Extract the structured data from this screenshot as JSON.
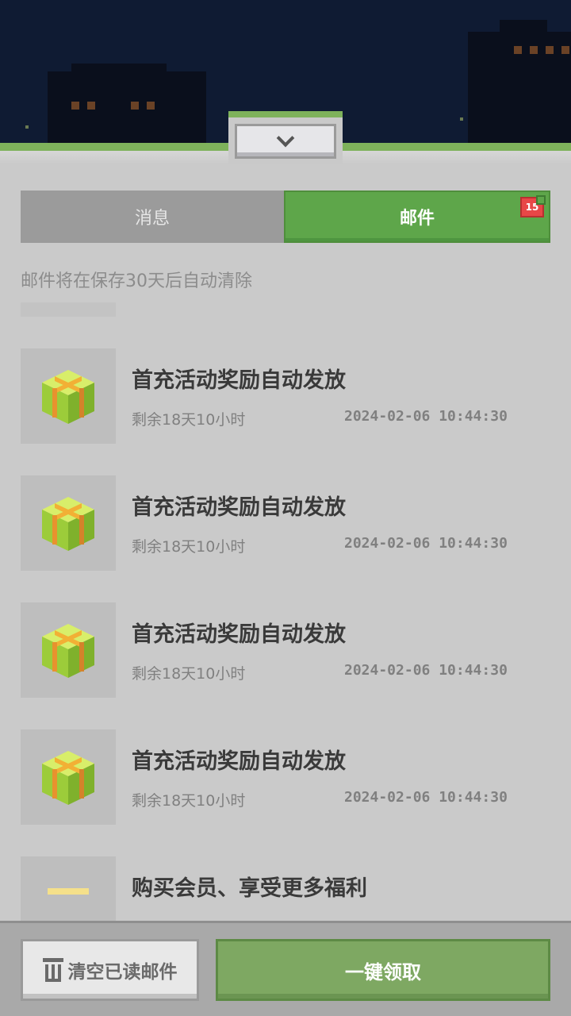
{
  "tabs": {
    "messages": "消息",
    "mail": "邮件",
    "mail_badge": "15"
  },
  "notice": "邮件将在保存30天后自动清除",
  "mails": [
    {
      "icon": "gift-box-icon",
      "title": "首充活动奖励自动发放",
      "remaining": "剩余18天10小时",
      "date": "2024-02-06 10:44:30"
    },
    {
      "icon": "gift-box-icon",
      "title": "首充活动奖励自动发放",
      "remaining": "剩余18天10小时",
      "date": "2024-02-06 10:44:30"
    },
    {
      "icon": "gift-box-icon",
      "title": "首充活动奖励自动发放",
      "remaining": "剩余18天10小时",
      "date": "2024-02-06 10:44:30"
    },
    {
      "icon": "gift-box-icon",
      "title": "首充活动奖励自动发放",
      "remaining": "剩余18天10小时",
      "date": "2024-02-06 10:44:30"
    },
    {
      "icon": "gift-box-icon",
      "title": "购买会员、享受更多福利",
      "remaining": "",
      "date": ""
    }
  ],
  "buttons": {
    "clear_read": "清空已读邮件",
    "claim_all": "一键领取"
  },
  "colors": {
    "accent_green": "#5ea64a",
    "badge_red": "#e84747",
    "gift_green": "#9ccc3a",
    "gift_ribbon": "#f2b035"
  }
}
